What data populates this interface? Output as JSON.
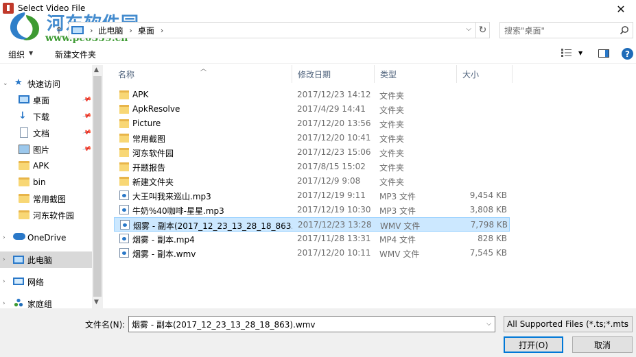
{
  "window": {
    "title": "Select Video File",
    "close_glyph": "✕"
  },
  "watermark": {
    "text": "河东软件园",
    "url": "www.pc0359.cn"
  },
  "address": {
    "crumbs": [
      "此电脑",
      "桌面"
    ],
    "search_placeholder": "搜索\"桌面\""
  },
  "toolbar": {
    "organize": "组织",
    "new_folder": "新建文件夹",
    "help": "?"
  },
  "nav": {
    "quick_access": "快速访问",
    "quick_items": [
      "桌面",
      "下载",
      "文档",
      "图片",
      "APK",
      "bin",
      "常用截图",
      "河东软件园"
    ],
    "onedrive": "OneDrive",
    "this_pc": "此电脑",
    "network": "网络",
    "homegroup": "家庭组"
  },
  "columns": {
    "name": "名称",
    "date": "修改日期",
    "type": "类型",
    "size": "大小"
  },
  "files": [
    {
      "name": "APK",
      "date": "2017/12/23 14:12",
      "type": "文件夹",
      "size": "",
      "kind": "folder"
    },
    {
      "name": "ApkResolve",
      "date": "2017/4/29 14:41",
      "type": "文件夹",
      "size": "",
      "kind": "folder"
    },
    {
      "name": "Picture",
      "date": "2017/12/20 13:56",
      "type": "文件夹",
      "size": "",
      "kind": "folder"
    },
    {
      "name": "常用截图",
      "date": "2017/12/20 10:41",
      "type": "文件夹",
      "size": "",
      "kind": "folder"
    },
    {
      "name": "河东软件园",
      "date": "2017/12/23 15:06",
      "type": "文件夹",
      "size": "",
      "kind": "folder"
    },
    {
      "name": "开题报告",
      "date": "2017/8/15 15:02",
      "type": "文件夹",
      "size": "",
      "kind": "folder"
    },
    {
      "name": "新建文件夹",
      "date": "2017/12/9 9:08",
      "type": "文件夹",
      "size": "",
      "kind": "folder"
    },
    {
      "name": "大王叫我来巡山.mp3",
      "date": "2017/12/19 9:11",
      "type": "MP3 文件",
      "size": "9,454 KB",
      "kind": "file"
    },
    {
      "name": "牛奶%40咖啡-星星.mp3",
      "date": "2017/12/19 10:30",
      "type": "MP3 文件",
      "size": "3,808 KB",
      "kind": "file"
    },
    {
      "name": "烟雾 - 副本(2017_12_23_13_28_18_863...",
      "date": "2017/12/23 13:28",
      "type": "WMV 文件",
      "size": "7,798 KB",
      "kind": "file",
      "selected": true
    },
    {
      "name": "烟雾 - 副本.mp4",
      "date": "2017/11/28 13:31",
      "type": "MP4 文件",
      "size": "828 KB",
      "kind": "file"
    },
    {
      "name": "烟雾 - 副本.wmv",
      "date": "2017/12/20 10:11",
      "type": "WMV 文件",
      "size": "7,545 KB",
      "kind": "file"
    }
  ],
  "bottom": {
    "filename_label": "文件名(N):",
    "filename_value": "烟雾 - 副本(2017_12_23_13_28_18_863).wmv",
    "filetype": "All Supported Files (*.ts;*.mts",
    "open": "打开(O)",
    "cancel": "取消"
  }
}
